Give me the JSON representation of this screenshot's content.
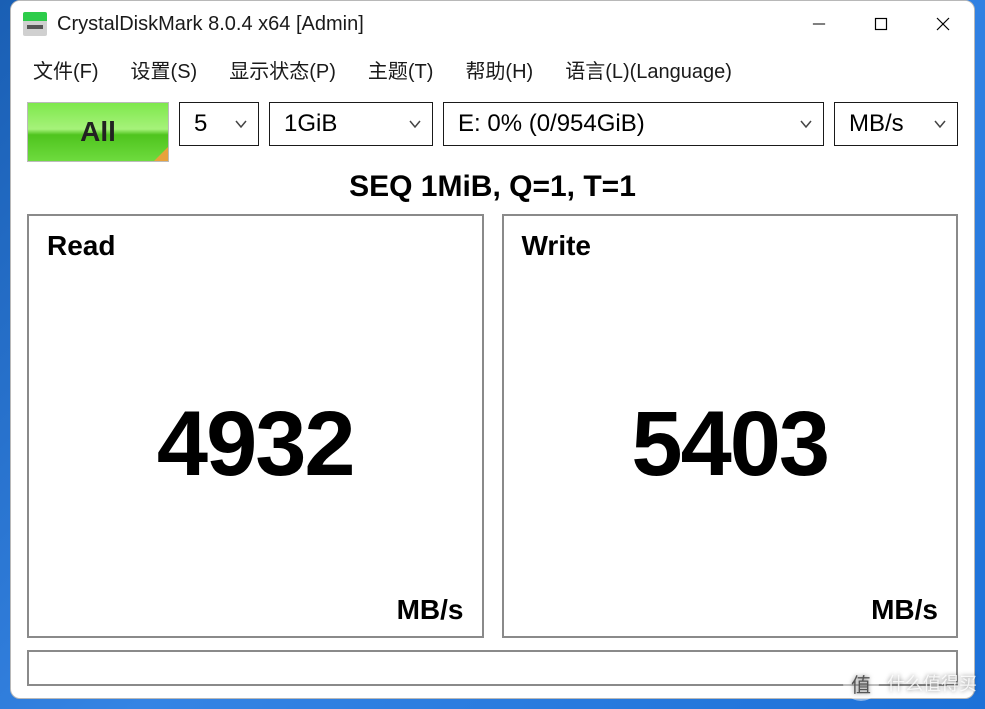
{
  "window": {
    "title": "CrystalDiskMark 8.0.4 x64 [Admin]"
  },
  "menu": {
    "file": "文件(F)",
    "settings": "设置(S)",
    "display": "显示状态(P)",
    "theme": "主题(T)",
    "help": "帮助(H)",
    "language": "语言(L)(Language)"
  },
  "toolbar": {
    "all_label": "All",
    "count": "5",
    "size": "1GiB",
    "drive": "E: 0% (0/954GiB)",
    "unit": "MB/s"
  },
  "test": {
    "label": "SEQ 1MiB, Q=1, T=1",
    "read_label": "Read",
    "write_label": "Write",
    "read_value": "4932",
    "write_value": "5403",
    "unit": "MB/s"
  },
  "watermark": {
    "logo_char": "值",
    "text": "什么值得买"
  }
}
